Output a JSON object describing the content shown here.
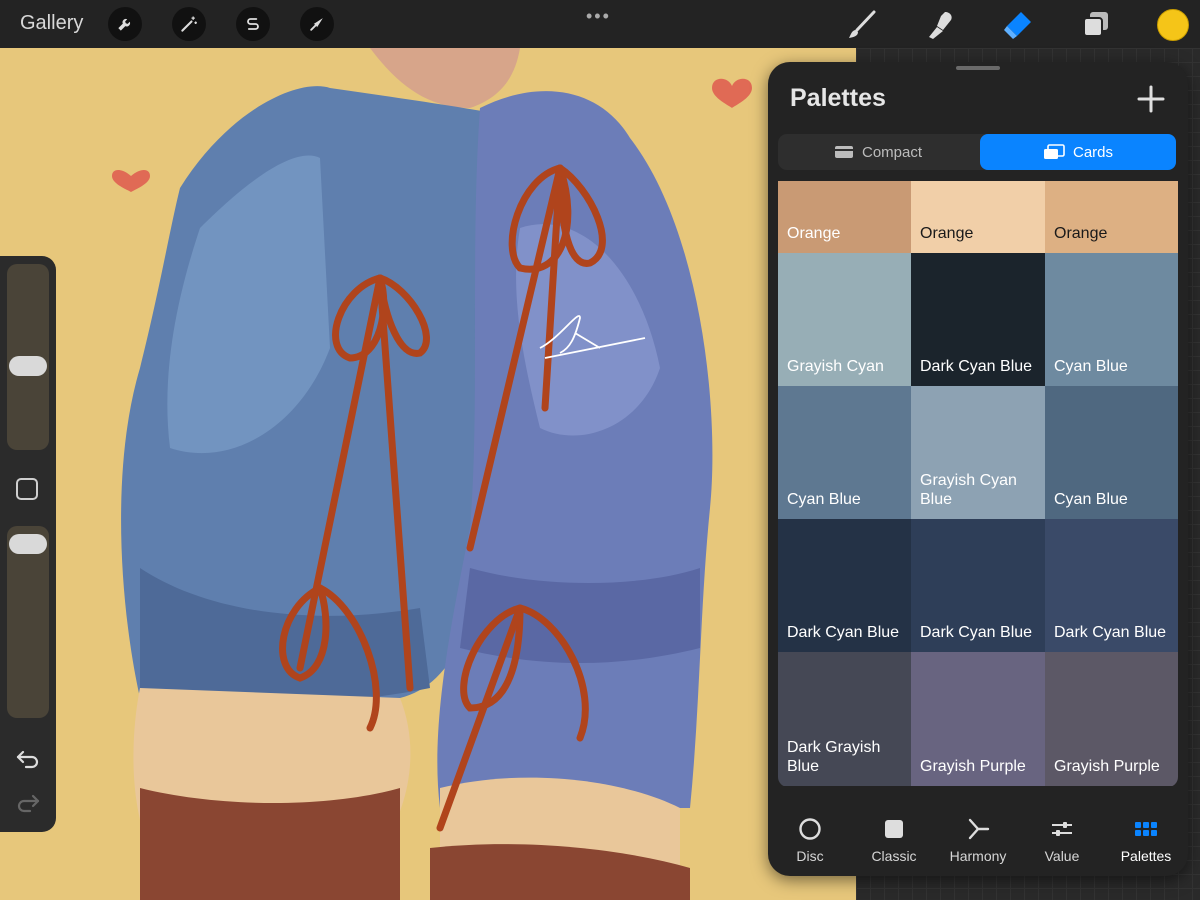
{
  "topbar": {
    "gallery_label": "Gallery",
    "tools_left": [
      "wrench-icon",
      "magic-wand-icon",
      "selection-s-icon",
      "transform-arrow-icon"
    ],
    "tools_right": [
      "brush-icon",
      "smudge-icon",
      "eraser-icon",
      "layers-icon"
    ],
    "active_tool": "eraser-icon",
    "current_color": "#F5C518"
  },
  "palettes": {
    "title": "Palettes",
    "view_modes": {
      "compact": "Compact",
      "cards": "Cards",
      "selected": "Cards"
    },
    "swatches": [
      {
        "name": "Orange",
        "color": "#C99A74",
        "text": "#ffffff"
      },
      {
        "name": "Orange",
        "color": "#F1CFA8",
        "text": "#1a1a1a"
      },
      {
        "name": "Orange",
        "color": "#DDB083",
        "text": "#1a1a1a"
      },
      {
        "name": "Grayish Cyan",
        "color": "#97AEB6",
        "text": "#ffffff"
      },
      {
        "name": "Dark Cyan Blue",
        "color": "#1B242C",
        "text": "#ffffff"
      },
      {
        "name": "Cyan Blue",
        "color": "#6E8AA0",
        "text": "#ffffff"
      },
      {
        "name": "Cyan Blue",
        "color": "#5E7891",
        "text": "#ffffff"
      },
      {
        "name": "Grayish Cyan Blue",
        "color": "#8DA2B3",
        "text": "#ffffff"
      },
      {
        "name": "Cyan Blue",
        "color": "#4F6880",
        "text": "#ffffff"
      },
      {
        "name": "Dark Cyan Blue",
        "color": "#243246",
        "text": "#ffffff"
      },
      {
        "name": "Dark Cyan Blue",
        "color": "#2E3E58",
        "text": "#ffffff"
      },
      {
        "name": "Dark Cyan Blue",
        "color": "#3A4A68",
        "text": "#ffffff"
      },
      {
        "name": "Dark Grayish Blue",
        "color": "#454855",
        "text": "#ffffff"
      },
      {
        "name": "Grayish Purple",
        "color": "#686480",
        "text": "#ffffff"
      },
      {
        "name": "Grayish Purple",
        "color": "#5C5866",
        "text": "#ffffff"
      }
    ]
  },
  "color_tabs": [
    {
      "label": "Disc",
      "icon": "disc-icon"
    },
    {
      "label": "Classic",
      "icon": "classic-square-icon"
    },
    {
      "label": "Harmony",
      "icon": "harmony-icon"
    },
    {
      "label": "Value",
      "icon": "value-sliders-icon"
    },
    {
      "label": "Palettes",
      "icon": "palettes-grid-icon"
    }
  ],
  "active_color_tab": "Palettes",
  "accent_color": "#0A84FF",
  "canvas_background": "#E7C77B"
}
